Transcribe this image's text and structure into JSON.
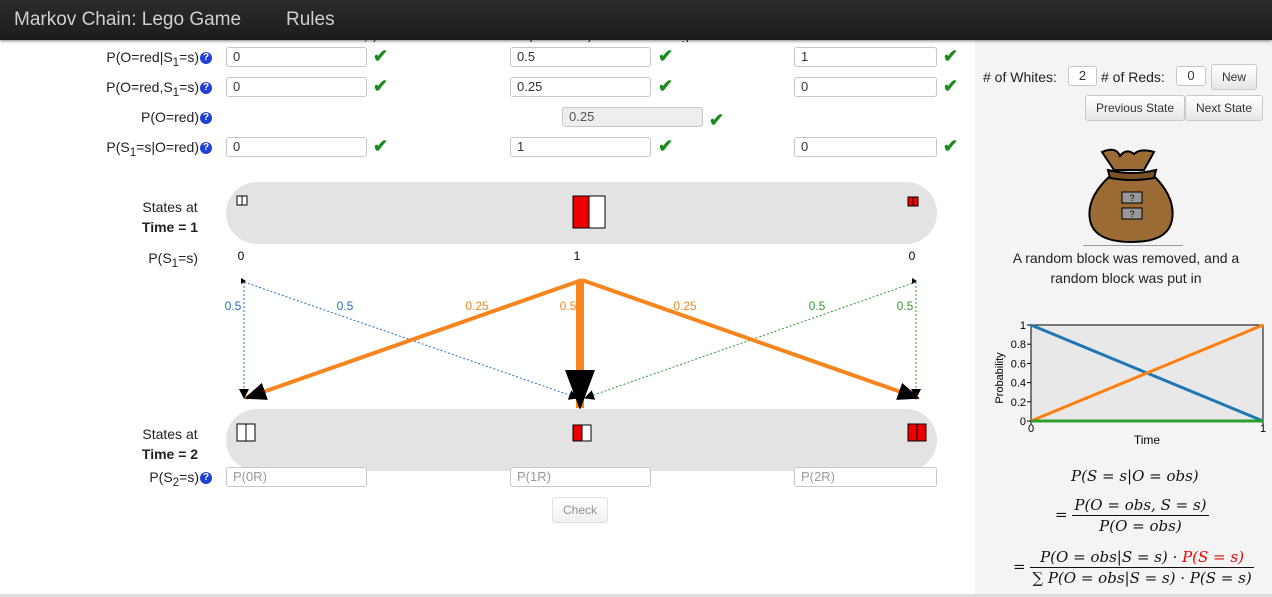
{
  "nav": {
    "brand": "Markov Chain: Lego Game",
    "rules": "Rules"
  },
  "intro_cutoff": "In other words, you want to calculate the probability of each state given we observe a red block.",
  "rows": [
    {
      "label_pre": "P(O=red|S",
      "label_sub": "1",
      "label_post": "=s)",
      "values": [
        "0",
        "0.5",
        "1"
      ],
      "disabled": [
        false,
        false,
        false
      ]
    },
    {
      "label_pre": "P(O=red,S",
      "label_sub": "1",
      "label_post": "=s)",
      "values": [
        "0",
        "0.25",
        "0"
      ],
      "disabled": [
        false,
        false,
        false
      ]
    },
    {
      "label_pre": "P(O=red)",
      "label_sub": "",
      "label_post": "",
      "values": [
        "0.25"
      ],
      "disabled": [
        true
      ]
    },
    {
      "label_pre": "P(S",
      "label_sub": "1",
      "label_post": "=s|O=red)",
      "values": [
        "0",
        "1",
        "0"
      ],
      "disabled": [
        false,
        false,
        false
      ]
    }
  ],
  "help_glyph": "?",
  "check_glyph": "✔",
  "states_t1": {
    "line1": "States at",
    "line2": "Time = 1"
  },
  "states_t2": {
    "line1": "States at",
    "line2": "Time = 2"
  },
  "p_s1": {
    "label_pre": "P(S",
    "label_sub": "1",
    "label_post": "=s)",
    "values": [
      "0",
      "1",
      "0"
    ]
  },
  "p_s2": {
    "label_pre": "P(S",
    "label_sub": "2",
    "label_post": "=s)",
    "placeholders": [
      "P(0R)",
      "P(1R)",
      "P(2R)"
    ]
  },
  "transition_labels": [
    "0.5",
    "0.5",
    "0.25",
    "0.5",
    "0.25",
    "0.5",
    "0.5"
  ],
  "check_button": "Check",
  "sidebar": {
    "whites_label": "# of Whites:",
    "whites_value": "2",
    "reds_label": "# of Reds:",
    "reds_value": "0",
    "new_button": "New",
    "prev_button": "Previous State",
    "next_button": "Next State",
    "bag_tag": "?",
    "bag_caption_1": "A random block was removed, and a",
    "bag_caption_2": "random block was put in"
  },
  "chart_data": {
    "type": "line",
    "xlabel": "Time",
    "ylabel": "Probability",
    "xlim": [
      0,
      1
    ],
    "ylim": [
      0,
      1
    ],
    "x_ticks": [
      "0",
      "1"
    ],
    "y_ticks": [
      "0",
      "0.2",
      "0.4",
      "0.6",
      "0.8",
      "1"
    ],
    "x": [
      0,
      1
    ],
    "series": [
      {
        "values": [
          1,
          0
        ],
        "color": "#1f77b4"
      },
      {
        "values": [
          0,
          1
        ],
        "color": "#ff7f0e"
      },
      {
        "values": [
          0,
          0
        ],
        "color": "#2ca02c"
      }
    ]
  },
  "formula": {
    "line1": "P(S = s|O = obs)",
    "eq": "=",
    "frac1_num": "P(O = obs, S = s)",
    "frac1_den": "P(O = obs)",
    "frac2_num_a": "P(O = obs|S = s) · ",
    "frac2_num_b": "P(S = s)",
    "frac2_den": "∑ P(O = obs|S = s) · P(S = s)"
  },
  "colors": {
    "orange": "#f7851e",
    "blue": "#1f6fc4",
    "green": "#2e9a2e",
    "red": "#ee0000",
    "check": "#1b8c1b"
  }
}
